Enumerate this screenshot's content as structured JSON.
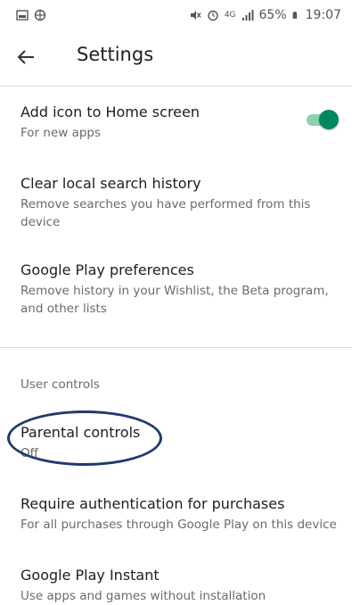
{
  "status_bar": {
    "battery": "65%",
    "time": "19:07",
    "network": "4G"
  },
  "app_bar": {
    "title": "Settings"
  },
  "items": [
    {
      "title": "Add icon to Home screen",
      "subtitle": "For new apps"
    },
    {
      "title": "Clear local search history",
      "subtitle": "Remove searches you have performed from this device"
    },
    {
      "title": "Google Play preferences",
      "subtitle": "Remove history in your Wishlist, the Beta program, and other lists"
    },
    {
      "title": "Parental controls",
      "subtitle": "Off"
    },
    {
      "title": "Require authentication for purchases",
      "subtitle": "For all purchases through Google Play on this device"
    },
    {
      "title": "Google Play Instant",
      "subtitle": "Use apps and games without installation"
    }
  ],
  "section_header": "User controls",
  "toggle_state": {
    "add_icon_home_screen": "on"
  },
  "colors": {
    "toggle_accent": "#01875f",
    "annotation": "#1f3a6e"
  },
  "icons": {
    "back": "arrow-left",
    "status_left": [
      "image-icon",
      "globe-icon"
    ],
    "status_right": [
      "mute-icon",
      "alarm-icon",
      "signal-icon",
      "battery-icon"
    ]
  }
}
